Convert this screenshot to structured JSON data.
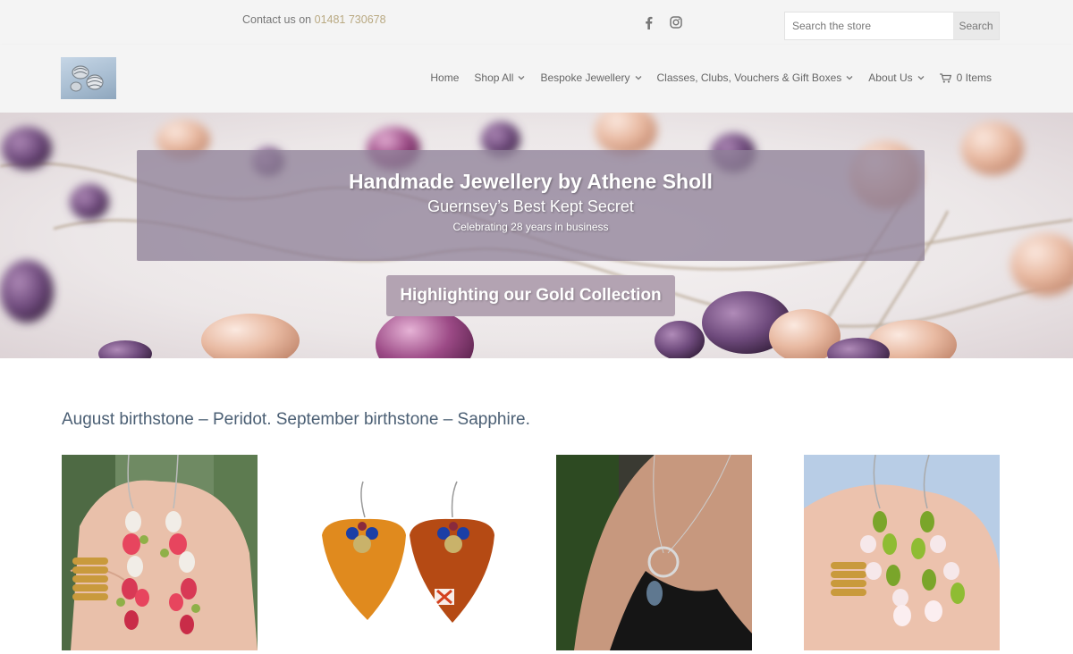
{
  "topbar": {
    "contact_label": "Contact us on",
    "phone": "01481 730678",
    "social_icons": [
      "facebook-icon",
      "instagram-icon"
    ],
    "search": {
      "placeholder": "Search the store",
      "button_label": "Search"
    }
  },
  "header": {
    "nav": {
      "home": "Home",
      "shop_all": "Shop All",
      "bespoke": "Bespoke Jewellery",
      "classes": "Classes, Clubs, Vouchers & Gift Boxes",
      "about": "About Us",
      "cart": "0 Items"
    }
  },
  "hero": {
    "title": "Handmade Jewellery by Athene Sholl",
    "subtitle": "Guernsey’s Best Kept Secret",
    "tagline": "Celebrating 28 years in business",
    "button_label": "Highlighting our Gold Collection"
  },
  "section": {
    "heading": "August birthstone – Peridot. September birthstone – Sapphire."
  },
  "colors": {
    "accent_phone": "#b9a982",
    "heading": "#4b5f74",
    "hero_box": "#8f8198",
    "hero_button": "#b3a3b2"
  }
}
